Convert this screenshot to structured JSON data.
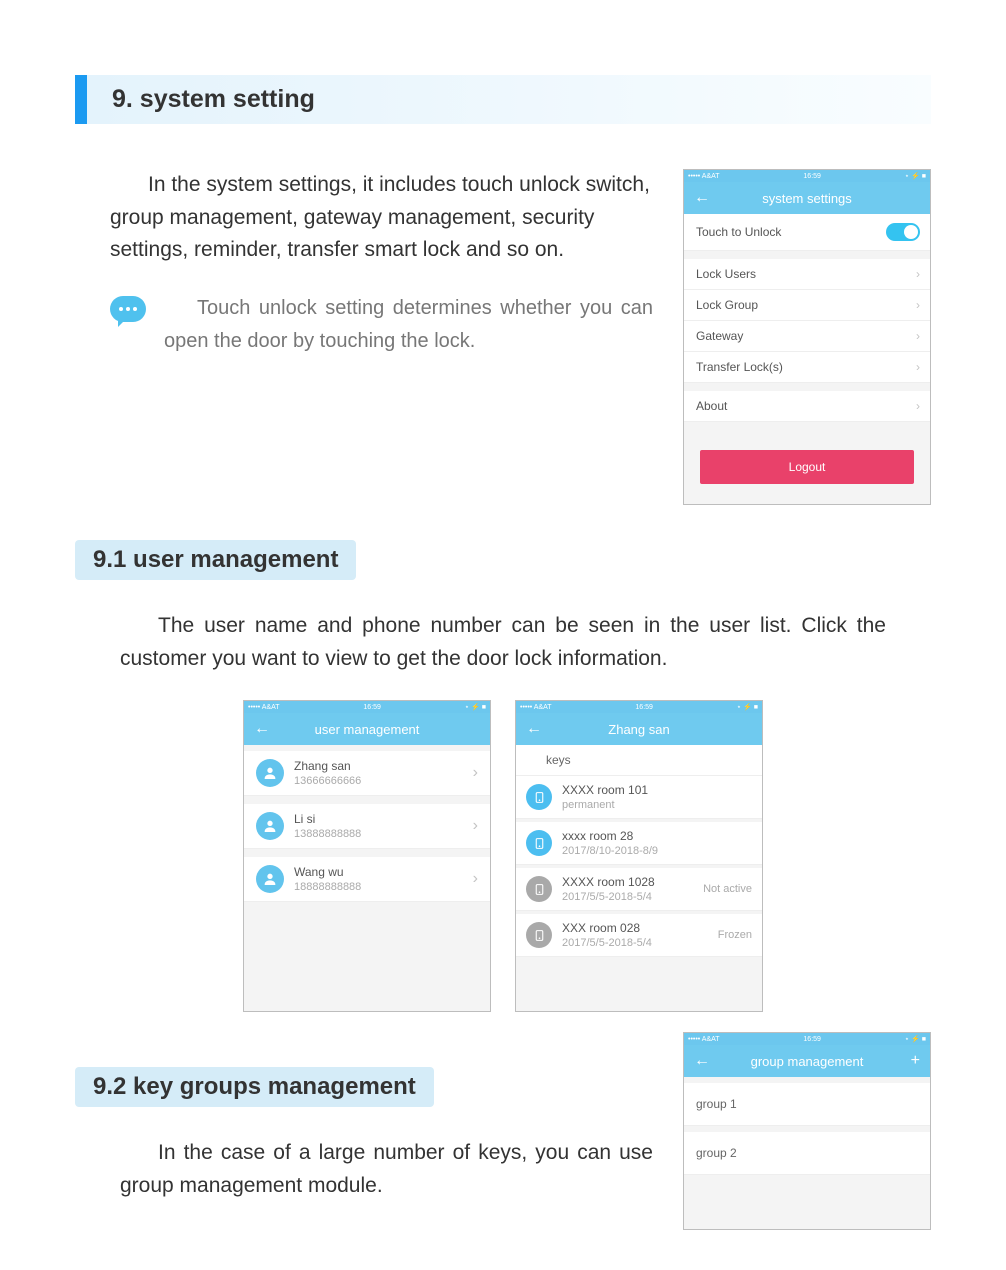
{
  "status": {
    "carrier": "••••• A&AT",
    "time": "16:59",
    "right": "⋆ ⚡ ■"
  },
  "section9": {
    "title": "9. system setting",
    "intro": "In the system settings, it includes touch unlock switch, group management, gateway management, security settings, reminder, transfer smart lock and so on.",
    "note": "Touch unlock setting determines whether you can open the door by touching the lock."
  },
  "phone_settings": {
    "title": "system settings",
    "touch_unlock": "Touch to Unlock",
    "items": [
      "Lock Users",
      "Lock Group",
      "Gateway",
      "Transfer Lock(s)"
    ],
    "about": "About",
    "logout": "Logout"
  },
  "section91": {
    "title": "9.1 user management",
    "para": "The user name and phone number can be seen in the user list. Click the customer you want to view to get the door lock information."
  },
  "phone_users": {
    "title": "user management",
    "users": [
      {
        "name": "Zhang san",
        "phone": "13666666666"
      },
      {
        "name": "Li si",
        "phone": "13888888888"
      },
      {
        "name": "Wang wu",
        "phone": "18888888888"
      }
    ]
  },
  "phone_user_detail": {
    "title": "Zhang san",
    "section": "keys",
    "keys": [
      {
        "room": "XXXX room 101",
        "sub": "permanent",
        "status": "",
        "active": true
      },
      {
        "room": "xxxx room 28",
        "sub": "2017/8/10-2018-8/9",
        "status": "",
        "active": true
      },
      {
        "room": "XXXX room 1028",
        "sub": "2017/5/5-2018-5/4",
        "status": "Not active",
        "active": false
      },
      {
        "room": "XXX room 028",
        "sub": "2017/5/5-2018-5/4",
        "status": "Frozen",
        "active": false
      }
    ]
  },
  "section92": {
    "title": "9.2 key groups management",
    "para": "In the case of a large number of keys, you can use group management module."
  },
  "phone_groups": {
    "title": "group management",
    "groups": [
      "group 1",
      "group 2"
    ]
  }
}
